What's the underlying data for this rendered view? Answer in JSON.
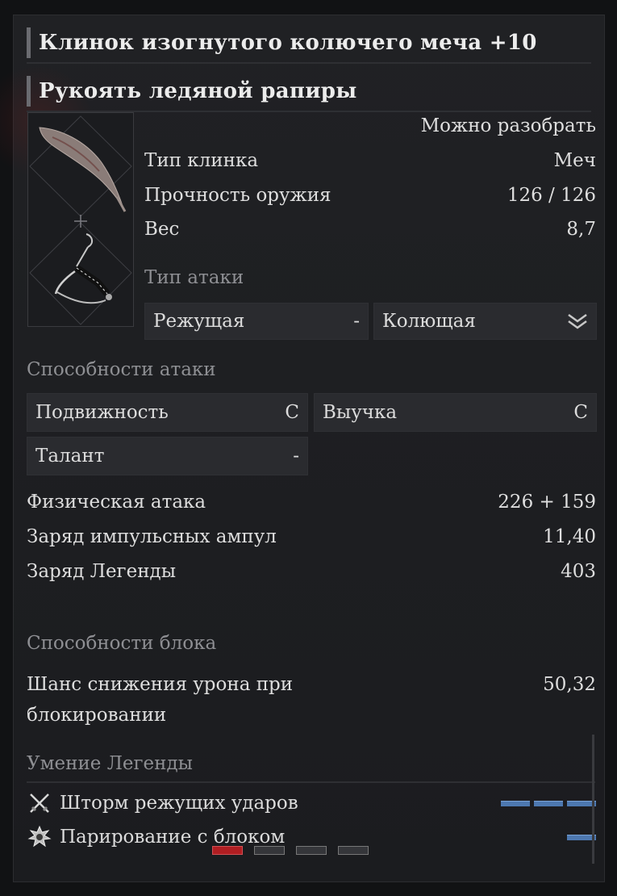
{
  "titles": {
    "blade": "Клинок изогнутого колючего меча +10",
    "handle": "Рукоять ледяной рапиры"
  },
  "item_info": {
    "disassemble": "Можно разобрать",
    "blade_type_label": "Тип клинка",
    "blade_type_value": "Меч",
    "durability_label": "Прочность оружия",
    "durability_value": "126 / 126",
    "weight_label": "Вес",
    "weight_value": "8,7"
  },
  "attack_type": {
    "label": "Тип атаки",
    "slot1_label": "Режущая",
    "slot1_value": "-",
    "slot2_label": "Колющая"
  },
  "attack_abilities": {
    "title": "Способности атаки",
    "items": [
      {
        "label": "Подвижность",
        "value": "C"
      },
      {
        "label": "Выучка",
        "value": "C"
      },
      {
        "label": "Талант",
        "value": "-"
      }
    ]
  },
  "stats": [
    {
      "label": "Физическая атака",
      "value": "226 + 159"
    },
    {
      "label": "Заряд импульсных ампул",
      "value": "11,40"
    },
    {
      "label": "Заряд Легенды",
      "value": "403"
    }
  ],
  "block_abilities": {
    "title": "Способности блока",
    "label_line1": "Шанс снижения урона при",
    "label_line2": "блокировании",
    "value": "50,32"
  },
  "legend_skills": {
    "title": "Умение Легенды",
    "items": [
      {
        "label": "Шторм режущих ударов",
        "icon": "crossed-swords-icon",
        "cost": 3
      },
      {
        "label": "Парирование с блоком",
        "icon": "shield-burst-icon",
        "cost": 1
      }
    ]
  },
  "pagination": {
    "pages": 4,
    "active": 1
  },
  "colors": {
    "accent_blue": "#4d78b0",
    "active_red": "#b01e22"
  }
}
